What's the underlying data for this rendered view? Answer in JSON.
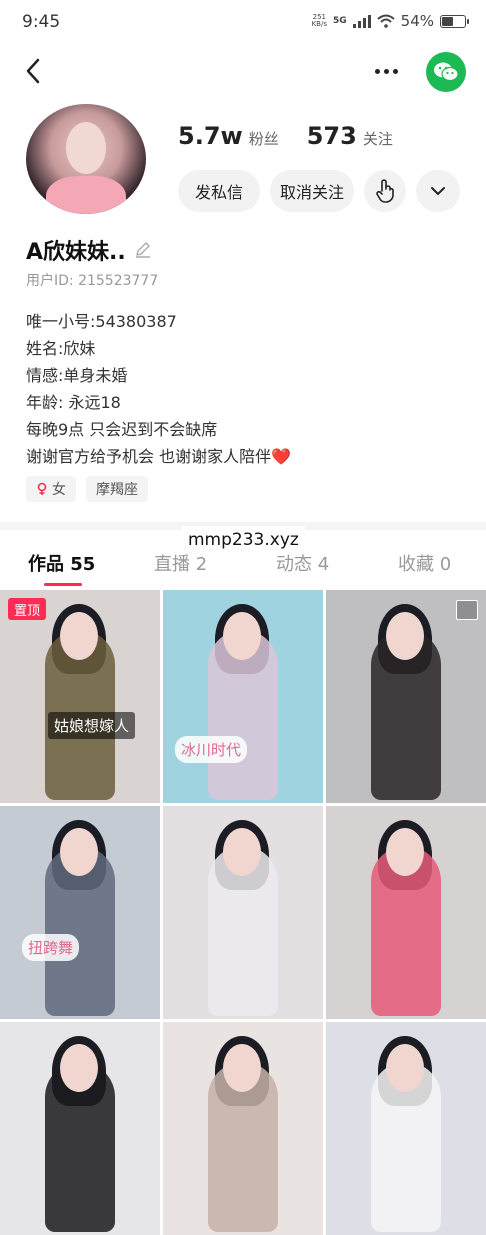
{
  "status_bar": {
    "time": "9:45",
    "net_speed": "251",
    "net_unit": "KB/s",
    "signal": "5G",
    "battery": "54%",
    "battery_level": 0.54
  },
  "nav": {
    "back_icon": "chevron-left-icon",
    "more_icon": "more-horizontal-icon",
    "share_icon": "wechat-icon",
    "share_color": "#1db954"
  },
  "profile": {
    "followers_count": "5.7w",
    "followers_label": "粉丝",
    "following_count": "573",
    "following_label": "关注",
    "message_button": "发私信",
    "unfollow_button": "取消关注",
    "nickname": "A欣妹妹..",
    "user_id": "用户ID: 215523777",
    "bio": [
      "唯一小号:54380387",
      "姓名:欣妹",
      "情感:单身未婚",
      "年龄: 永远18",
      "每晚9点 只会迟到不会缺席",
      "谢谢官方给予机会 也谢谢家人陪伴❤️"
    ],
    "tags": [
      "女",
      "摩羯座"
    ]
  },
  "watermark": "mmp233.xyz",
  "tabs": [
    {
      "label": "作品 55",
      "active": true
    },
    {
      "label": "直播 2",
      "active": false
    },
    {
      "label": "动态 4",
      "active": false
    },
    {
      "label": "收藏 0",
      "active": false
    }
  ],
  "accent_color": "#fe2c55",
  "videos": [
    {
      "badge": "置顶",
      "caption": "姑娘想嫁人",
      "bg": "#d9d4d2",
      "outfit": "#6b5e3c"
    },
    {
      "badge": "",
      "caption": "冰川时代",
      "bg": "#9fd3e0",
      "outfit": "#d9c6d8"
    },
    {
      "badge": "",
      "caption": "",
      "bg": "#bfbfc2",
      "outfit": "#2a2426"
    },
    {
      "badge": "",
      "caption": "扭跨舞",
      "bg": "#c4cbd3",
      "outfit": "#5f6a7d"
    },
    {
      "badge": "",
      "caption": "",
      "bg": "#e4dfe0",
      "outfit": "#ecebf0"
    },
    {
      "badge": "",
      "caption": "",
      "bg": "#d7d2d2",
      "outfit": "#e85a7a"
    },
    {
      "badge": "",
      "caption": "",
      "bg": "#e6e6e8",
      "outfit": "#1a1a1f"
    },
    {
      "badge": "",
      "caption": "",
      "bg": "#e9e4e1",
      "outfit": "#c6b0a8"
    },
    {
      "badge": "",
      "caption": "",
      "bg": "#dddfe6",
      "outfit": "#f6f6f6"
    }
  ]
}
